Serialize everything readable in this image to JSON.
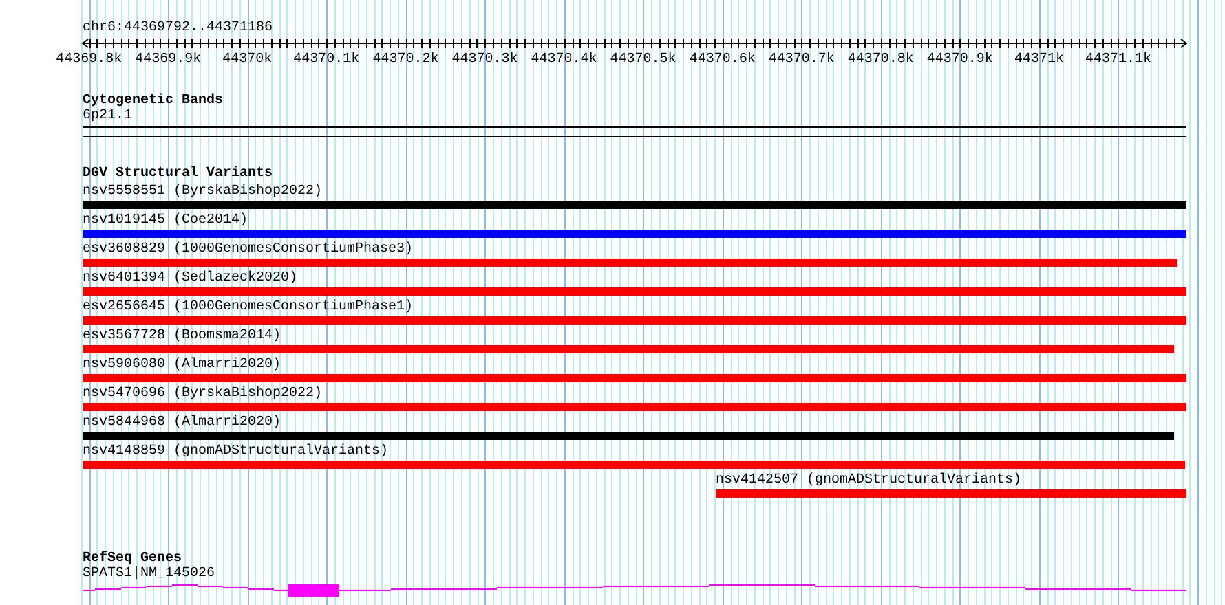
{
  "location": "chr6:44369792..44371186",
  "ruler": {
    "tick_labels": [
      "44369.8k",
      "44369.9k",
      "44370k",
      "44370.1k",
      "44370.2k",
      "44370.3k",
      "44370.4k",
      "44370.5k",
      "44370.6k",
      "44370.7k",
      "44370.8k",
      "44370.9k",
      "44371k",
      "44371.1k"
    ]
  },
  "tracks": [
    {
      "kind": "cytobands",
      "title": "Cytogenetic Bands",
      "features": [
        {
          "label": "6p21.1"
        }
      ]
    },
    {
      "kind": "variants",
      "title": "DGV Structural Variants",
      "features": [
        {
          "label": "nsv5558551 (ByrskaBishop2022)",
          "color": "#000000"
        },
        {
          "label": "nsv1019145 (Coe2014)",
          "color": "#0000ff"
        },
        {
          "label": "esv3608829 (1000GenomesConsortiumPhase3)",
          "color": "#ff0000"
        },
        {
          "label": "nsv6401394 (Sedlazeck2020)",
          "color": "#ff0000"
        },
        {
          "label": "esv2656645 (1000GenomesConsortiumPhase1)",
          "color": "#ff0000"
        },
        {
          "label": "esv3567728 (Boomsma2014)",
          "color": "#ff0000"
        },
        {
          "label": "nsv5906080 (Almarri2020)",
          "color": "#ff0000"
        },
        {
          "label": "nsv5470696 (ByrskaBishop2022)",
          "color": "#ff0000"
        },
        {
          "label": "nsv5844968 (Almarri2020)",
          "color": "#000000"
        },
        {
          "label": "nsv4148859 (gnomADStructuralVariants)",
          "color": "#ff0000"
        },
        {
          "label": "nsv4142507 (gnomADStructuralVariants)",
          "color": "#ff0000",
          "kind": "partial"
        }
      ]
    },
    {
      "kind": "genes",
      "title": "RefSeq Genes",
      "features": [
        {
          "label": "SPATS1|NM_145026"
        }
      ]
    }
  ]
}
